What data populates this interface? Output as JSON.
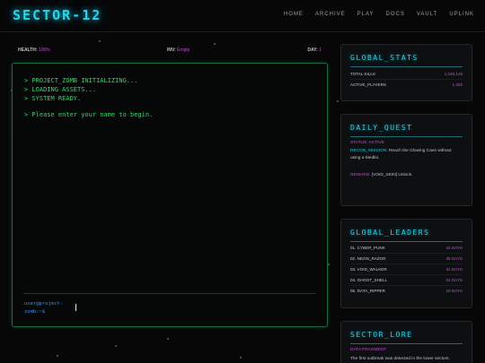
{
  "header": {
    "logo": "SECTOR-12",
    "nav": [
      "HOME",
      "ARCHIVE",
      "PLAY",
      "DOCS",
      "VAULT",
      "UPLINK"
    ]
  },
  "status": {
    "health_label": "HEALTH:",
    "health_value": "100%",
    "inv_label": "INV:",
    "inv_value": "Empty",
    "day_label": "DAY:",
    "day_value": "1"
  },
  "terminal": {
    "lines": [
      "> PROJECT_ZOMB INITIALIZING...",
      "> LOADING ASSETS...",
      "> SYSTEM READY.",
      "> Please enter your name to begin."
    ],
    "prompt_line1": "user@project-",
    "prompt_line2": "zomb:~$",
    "input_value": ""
  },
  "global_stats": {
    "title": "GLOBAL_STATS",
    "rows": [
      {
        "key": "TOTAL KILLS",
        "value": "1,245,129"
      },
      {
        "key": "ACTIVE_PLAYERS",
        "value": "1,402"
      }
    ]
  },
  "daily_quest": {
    "title": "DAILY_QUEST",
    "status": "STATUS: ACTIVE",
    "mission_label": "RECON_MISSION:",
    "mission_text": "Reach the Glowing Cave without using a Medkit.",
    "reward_label": "REWARD:",
    "reward_text": "[VOID_SKIN] Unlock."
  },
  "leaders": {
    "title": "GLOBAL_LEADERS",
    "rows": [
      {
        "name": "01. CYBER_PUNK",
        "days": "42 DAYS"
      },
      {
        "name": "02. NEON_RAZOR",
        "days": "38 DAYS"
      },
      {
        "name": "03. VOID_WALKER",
        "days": "31 DAYS"
      },
      {
        "name": "04. GHOST_SHELL",
        "days": "24 DAYS"
      },
      {
        "name": "05. DATA_RIPPER",
        "days": "19 DAYS"
      }
    ]
  },
  "lore": {
    "title": "SECTOR_LORE",
    "subtitle": "DATA FRAGMENT",
    "text": "The first outbreak was detected in the lower sectors."
  },
  "colors": {
    "accent": "#27d4e8",
    "terminal_green": "#33d96a",
    "magenta": "#c84bd8"
  }
}
